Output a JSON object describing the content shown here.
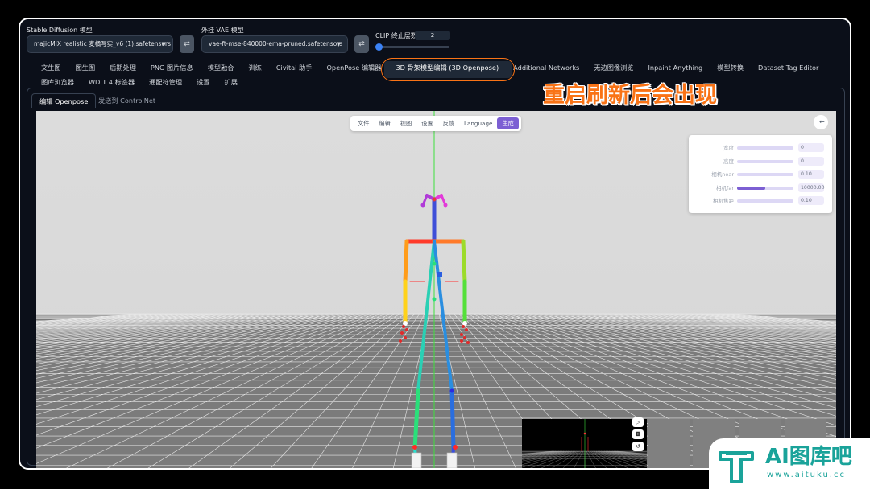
{
  "top": {
    "sd_model_label": "Stable Diffusion 模型",
    "sd_model_value": "majicMIX realistic 麦橘写实_v6 (1).safetensors [",
    "vae_label": "外挂 VAE 模型",
    "vae_value": "vae-ft-mse-840000-ema-pruned.safetensors",
    "clip_label": "CLIP 终止层数",
    "clip_value": "2",
    "clip_fraction": 0.0,
    "refresh_icon": "swap-icon"
  },
  "tabs_row1": [
    "文生图",
    "图生图",
    "后期处理",
    "PNG 图片信息",
    "模型融合",
    "训练",
    "Civitai 助手",
    "OpenPose 编辑器",
    "3D 骨架模型编辑 (3D Openpose)",
    "Additional Networks",
    "无边图像浏览",
    "Inpaint Anything",
    "模型转换",
    "Dataset Tag Editor"
  ],
  "tabs_row2": [
    "图库浏览器",
    "WD 1.4 标签器",
    "通配符管理",
    "设置",
    "扩展"
  ],
  "active_tab": "3D 骨架模型编辑 (3D Openpose)",
  "subtabs": [
    "编辑 Openpose",
    "发送到 ControlNet"
  ],
  "editor": {
    "menu": [
      "文件",
      "编辑",
      "视图",
      "设置",
      "反馈",
      "Language",
      "生成"
    ],
    "settings": [
      {
        "label": "宽度",
        "value": "0",
        "fraction": 0.0
      },
      {
        "label": "高度",
        "value": "0",
        "fraction": 0.0
      },
      {
        "label": "相机near",
        "value": "0.10",
        "fraction": 0.0
      },
      {
        "label": "相机far",
        "value": "10000.00",
        "fraction": 0.5
      },
      {
        "label": "相机焦距",
        "value": "0.10",
        "fraction": 0.0
      }
    ],
    "accent_color": "#7c5fd3",
    "grid_color": "#ffffff",
    "background_color": "#d9d9d9"
  },
  "overlay_caption": "重启刷新后会出现",
  "watermark": {
    "title": "AI图库吧",
    "url": "www.aituku.cc"
  }
}
